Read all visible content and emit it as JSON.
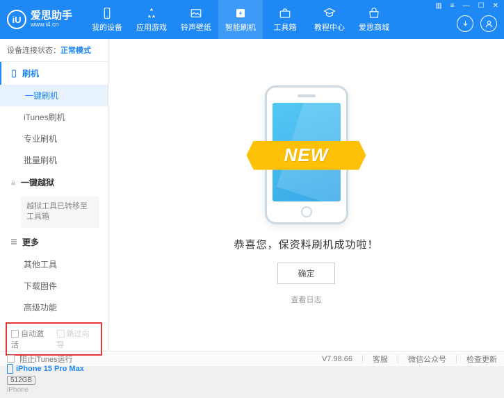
{
  "brand": {
    "title": "爱思助手",
    "url": "www.i4.cn",
    "logo": "iU"
  },
  "nav": [
    {
      "label": "我的设备"
    },
    {
      "label": "应用游戏"
    },
    {
      "label": "铃声壁纸"
    },
    {
      "label": "智能刷机"
    },
    {
      "label": "工具箱"
    },
    {
      "label": "教程中心"
    },
    {
      "label": "爱思商城"
    }
  ],
  "sidebar": {
    "status_label": "设备连接状态：",
    "status_value": "正常模式",
    "flash_head": "刷机",
    "items": [
      {
        "label": "一键刷机"
      },
      {
        "label": "iTunes刷机"
      },
      {
        "label": "专业刷机"
      },
      {
        "label": "批量刷机"
      }
    ],
    "jailbreak_head": "一键越狱",
    "jailbreak_transfer": "越狱工具已转移至工具箱",
    "more_head": "更多",
    "more_items": [
      {
        "label": "其他工具"
      },
      {
        "label": "下载固件"
      },
      {
        "label": "高级功能"
      }
    ],
    "options": {
      "auto_activate": "自动激活",
      "skip_setup": "跳过向导"
    },
    "device": {
      "name": "iPhone 15 Pro Max",
      "storage": "512GB",
      "type": "iPhone"
    }
  },
  "main": {
    "ribbon_text": "NEW",
    "success_message": "恭喜您，保资料刷机成功啦！",
    "ok_button": "确定",
    "view_log": "查看日志"
  },
  "footer": {
    "block_itunes": "阻止iTunes运行",
    "version": "V7.98.66",
    "links": [
      "客服",
      "微信公众号",
      "检查更新"
    ]
  }
}
